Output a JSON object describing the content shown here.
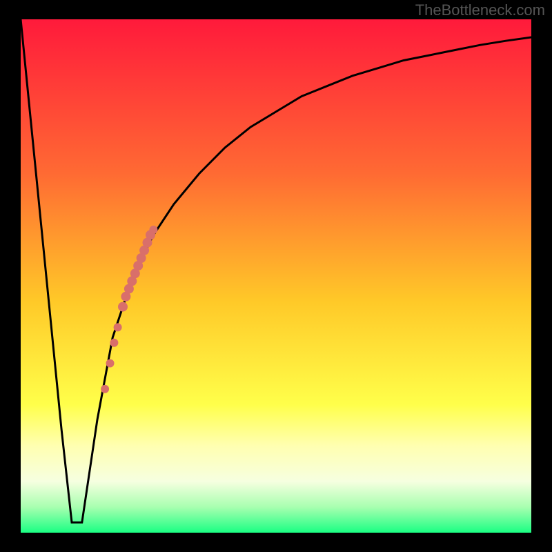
{
  "watermark": "TheBottleneck.com",
  "colors": {
    "black": "#000000",
    "curve": "#000000",
    "markers": "#d96f6a"
  },
  "chart_data": {
    "type": "line",
    "title": "",
    "xlabel": "",
    "ylabel": "",
    "xlim": [
      0,
      100
    ],
    "ylim": [
      0,
      100
    ],
    "grid": false,
    "gradient_stops": [
      {
        "offset": 0.0,
        "color": "#ff1a3b"
      },
      {
        "offset": 0.3,
        "color": "#ff6a33"
      },
      {
        "offset": 0.55,
        "color": "#ffc928"
      },
      {
        "offset": 0.75,
        "color": "#ffff4a"
      },
      {
        "offset": 0.83,
        "color": "#ffffb0"
      },
      {
        "offset": 0.9,
        "color": "#f6ffe0"
      },
      {
        "offset": 0.95,
        "color": "#a8ffb0"
      },
      {
        "offset": 1.0,
        "color": "#1aff83"
      }
    ],
    "series": [
      {
        "name": "bottleneck-curve",
        "x": [
          0,
          2,
          4,
          6,
          8,
          10,
          11,
          12,
          15,
          18,
          22,
          26,
          30,
          35,
          40,
          45,
          50,
          55,
          60,
          65,
          70,
          75,
          80,
          85,
          90,
          95,
          100
        ],
        "y": [
          100,
          80,
          60,
          40,
          20,
          2,
          2,
          2,
          22,
          38,
          50,
          58,
          64,
          70,
          75,
          79,
          82,
          85,
          87,
          89,
          90.5,
          92,
          93,
          94,
          95,
          95.8,
          96.5
        ]
      }
    ],
    "markers": [
      {
        "x": 20.0,
        "y": 44.0,
        "r": 7
      },
      {
        "x": 20.6,
        "y": 46.0,
        "r": 7
      },
      {
        "x": 21.2,
        "y": 47.5,
        "r": 7
      },
      {
        "x": 21.8,
        "y": 49.0,
        "r": 7
      },
      {
        "x": 22.4,
        "y": 50.5,
        "r": 7
      },
      {
        "x": 23.0,
        "y": 52.0,
        "r": 7
      },
      {
        "x": 23.6,
        "y": 53.5,
        "r": 7
      },
      {
        "x": 24.2,
        "y": 55.0,
        "r": 7
      },
      {
        "x": 24.8,
        "y": 56.5,
        "r": 7
      },
      {
        "x": 25.4,
        "y": 58.0,
        "r": 7
      },
      {
        "x": 26.0,
        "y": 59.0,
        "r": 6
      },
      {
        "x": 19.0,
        "y": 40.0,
        "r": 6
      },
      {
        "x": 18.3,
        "y": 37.0,
        "r": 6
      },
      {
        "x": 17.5,
        "y": 33.0,
        "r": 6
      },
      {
        "x": 16.5,
        "y": 28.0,
        "r": 6
      }
    ]
  }
}
